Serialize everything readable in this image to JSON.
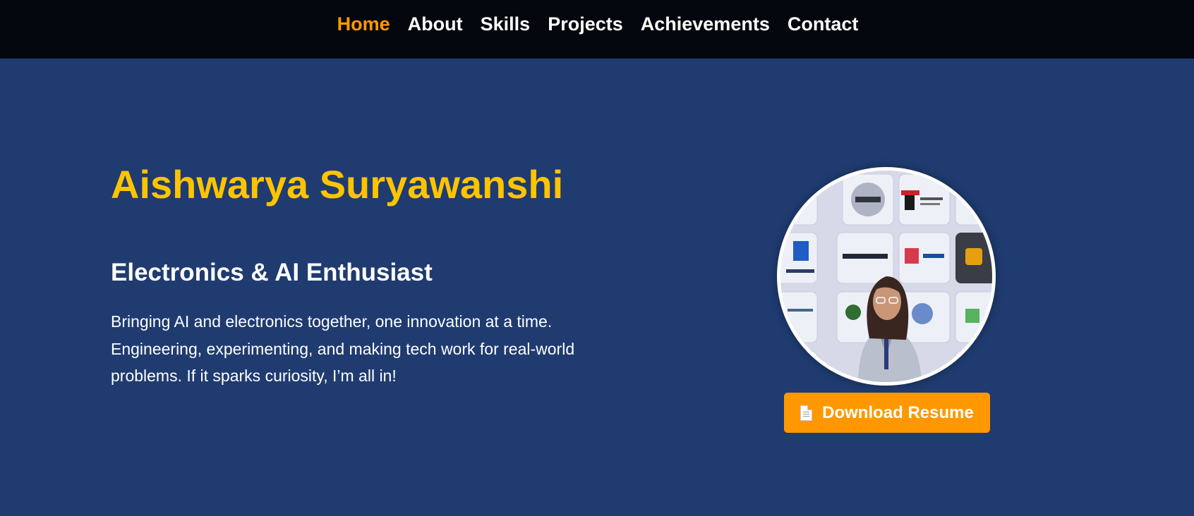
{
  "nav": {
    "items": [
      {
        "label": "Home",
        "active": true
      },
      {
        "label": "About",
        "active": false
      },
      {
        "label": "Skills",
        "active": false
      },
      {
        "label": "Projects",
        "active": false
      },
      {
        "label": "Achievements",
        "active": false
      },
      {
        "label": "Contact",
        "active": false
      }
    ]
  },
  "hero": {
    "name": "Aishwarya Suryawanshi",
    "tagline": "Electronics & AI Enthusiast",
    "description": "Bringing AI and electronics together, one innovation at a time. Engineering, experimenting, and making tech work for real-world problems. If it sparks curiosity, I’m all in!",
    "avatar_icon": "profile-photo",
    "resume_button": {
      "icon": "document-icon",
      "label": "Download Resume"
    }
  },
  "colors": {
    "nav_background": "#03060c",
    "hero_background": "#1f3b70",
    "name_color": "#ffc400",
    "active_link": "#ff9a00",
    "button_background": "#ff9800"
  }
}
